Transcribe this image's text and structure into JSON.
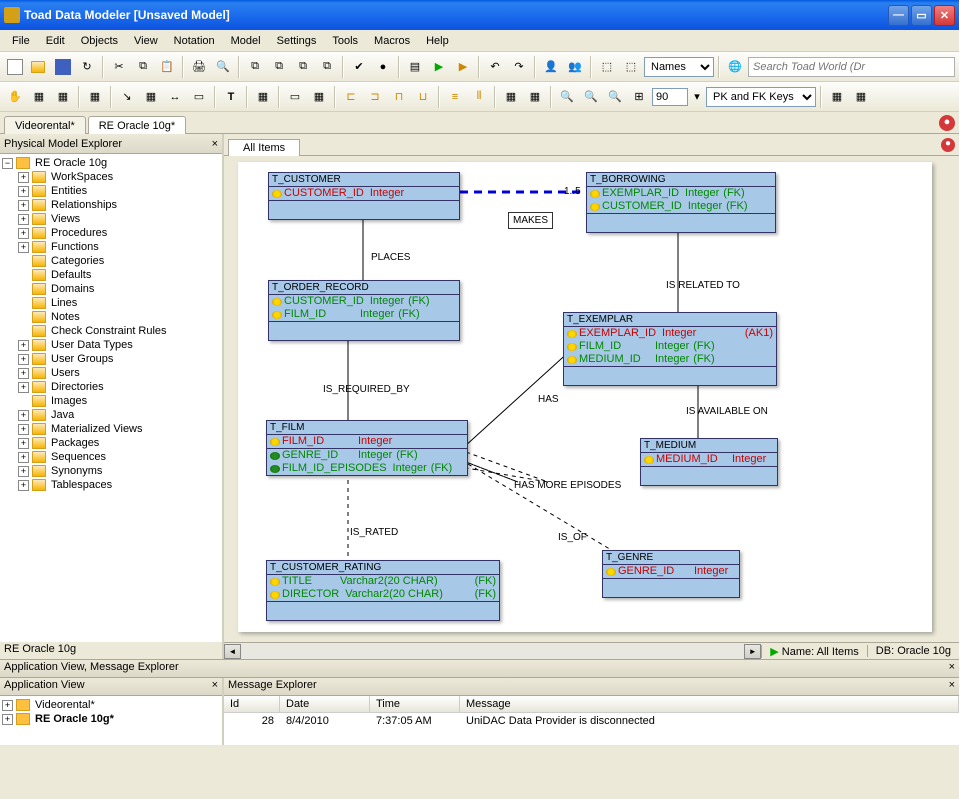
{
  "window": {
    "title": "Toad Data Modeler   [Unsaved Model]"
  },
  "menu": [
    "File",
    "Edit",
    "Objects",
    "View",
    "Notation",
    "Model",
    "Settings",
    "Tools",
    "Macros",
    "Help"
  ],
  "toolbar1": {
    "namesDropdown": "Names",
    "searchPlaceholder": "Search Toad World (Dr"
  },
  "toolbar2": {
    "zoom": "90",
    "keysDropdown": "PK and FK Keys"
  },
  "docTabs": [
    {
      "label": "Videorental*",
      "active": false
    },
    {
      "label": "RE Oracle 10g*",
      "active": true
    }
  ],
  "leftPanel": {
    "title": "Physical Model Explorer",
    "root": "RE Oracle 10g",
    "items": [
      {
        "label": "WorkSpaces",
        "expandable": true
      },
      {
        "label": "Entities",
        "expandable": true
      },
      {
        "label": "Relationships",
        "expandable": true
      },
      {
        "label": "Views",
        "expandable": true
      },
      {
        "label": "Procedures",
        "expandable": true
      },
      {
        "label": "Functions",
        "expandable": true
      },
      {
        "label": "Categories",
        "expandable": false
      },
      {
        "label": "Defaults",
        "expandable": false
      },
      {
        "label": "Domains",
        "expandable": false
      },
      {
        "label": "Lines",
        "expandable": false
      },
      {
        "label": "Notes",
        "expandable": false
      },
      {
        "label": "Check Constraint Rules",
        "expandable": false
      },
      {
        "label": "User Data Types",
        "expandable": true
      },
      {
        "label": "User Groups",
        "expandable": true
      },
      {
        "label": "Users",
        "expandable": true
      },
      {
        "label": "Directories",
        "expandable": true
      },
      {
        "label": "Images",
        "expandable": false
      },
      {
        "label": "Java",
        "expandable": true
      },
      {
        "label": "Materialized Views",
        "expandable": true
      },
      {
        "label": "Packages",
        "expandable": true
      },
      {
        "label": "Sequences",
        "expandable": true
      },
      {
        "label": "Synonyms",
        "expandable": true
      },
      {
        "label": "Tablespaces",
        "expandable": true
      }
    ],
    "status": "RE Oracle 10g"
  },
  "canvas": {
    "tab": "All Items",
    "statusName": "Name: All Items",
    "statusDB": "DB: Oracle 10g",
    "entities": {
      "customer": {
        "title": "T_CUSTOMER",
        "cols": [
          {
            "name": "CUSTOMER_ID",
            "type": "Integer",
            "pk": true
          }
        ]
      },
      "borrowing": {
        "title": "T_BORROWING",
        "cols": [
          {
            "name": "EXEMPLAR_ID",
            "type": "Integer",
            "fk": true,
            "pk": true
          },
          {
            "name": "CUSTOMER_ID",
            "type": "Integer",
            "fk": true,
            "pk": true
          }
        ]
      },
      "order": {
        "title": "T_ORDER_RECORD",
        "cols": [
          {
            "name": "CUSTOMER_ID",
            "type": "Integer",
            "fk": true,
            "pk": true
          },
          {
            "name": "FILM_ID",
            "type": "Integer",
            "fk": true,
            "pk": true
          }
        ]
      },
      "exemplar": {
        "title": "T_EXEMPLAR",
        "cols": [
          {
            "name": "EXEMPLAR_ID",
            "type": "Integer",
            "pk": true,
            "ak": "(AK1)"
          },
          {
            "name": "FILM_ID",
            "type": "Integer",
            "fk": true,
            "pk": true
          },
          {
            "name": "MEDIUM_ID",
            "type": "Integer",
            "fk": true,
            "pk": true
          }
        ]
      },
      "film": {
        "title": "T_FILM",
        "cols": [
          {
            "name": "FILM_ID",
            "type": "Integer",
            "pk": true
          },
          {
            "name": "GENRE_ID",
            "type": "Integer",
            "fk": true
          },
          {
            "name": "FILM_ID_EPISODES",
            "type": "Integer",
            "fk": true
          }
        ]
      },
      "medium": {
        "title": "T_MEDIUM",
        "cols": [
          {
            "name": "MEDIUM_ID",
            "type": "Integer",
            "pk": true
          }
        ]
      },
      "genre": {
        "title": "T_GENRE",
        "cols": [
          {
            "name": "GENRE_ID",
            "type": "Integer",
            "pk": true
          }
        ]
      },
      "rating": {
        "title": "T_CUSTOMER_RATING",
        "cols": [
          {
            "name": "TITLE",
            "type": "Varchar2(20 CHAR)",
            "fk": true,
            "pk": true
          },
          {
            "name": "DIRECTOR",
            "type": "Varchar2(20 CHAR)",
            "fk": true,
            "pk": true
          }
        ]
      }
    },
    "relations": {
      "makes": "MAKES",
      "makesCard": "1..5",
      "places": "PLACES",
      "isRelatedTo": "IS RELATED TO",
      "isRequiredBy": "IS_REQUIRED_BY",
      "has": "HAS",
      "isAvailableOn": "IS AVAILABLE ON",
      "hasMoreEpisodes": "HAS MORE EPISODES",
      "isRated": "IS_RATED",
      "isOf": "IS_OF"
    }
  },
  "bottom": {
    "combinedTitle": "Application View, Message Explorer",
    "appViewTitle": "Application View",
    "msgTitle": "Message Explorer",
    "appItems": [
      {
        "label": "Videorental*"
      },
      {
        "label": "RE Oracle 10g*",
        "bold": true
      }
    ],
    "msgCols": {
      "id": "Id",
      "date": "Date",
      "time": "Time",
      "message": "Message"
    },
    "msgRow": {
      "id": "28",
      "date": "8/4/2010",
      "time": "7:37:05 AM",
      "message": "UniDAC Data Provider is disconnected"
    }
  }
}
